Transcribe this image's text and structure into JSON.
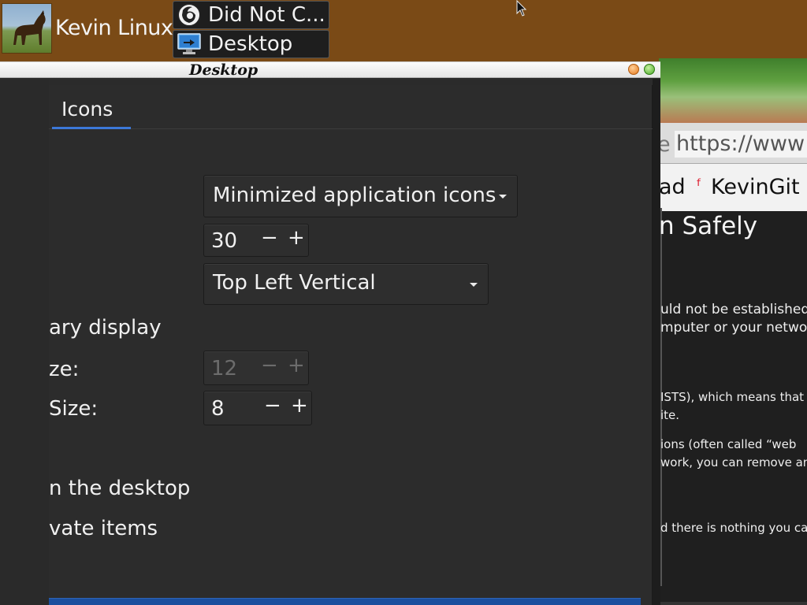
{
  "top_panel": {
    "user_name": "Kevin Linux",
    "tasks": [
      {
        "label": "Did Not C...",
        "icon": "firefox-icon"
      },
      {
        "label": "Desktop",
        "icon": "desktop-monitor-icon"
      }
    ]
  },
  "dock": {
    "items": [
      {
        "name": "internet-explorer-icon"
      },
      {
        "name": "file-cabinet-icon"
      },
      {
        "name": "terminal-icon"
      },
      {
        "name": "magnifier-search-icon"
      }
    ]
  },
  "browser": {
    "url_prefix": "e",
    "url": "https://www",
    "bookmarks": {
      "first": "ad",
      "second": "KevinGit"
    },
    "heading": "n Safely",
    "lines": [
      "uld not be established.",
      "mputer or your network",
      "ISTS), which means that",
      "ite.",
      "ions (often called “web",
      "work, you can remove and",
      "d there is nothing you can"
    ]
  },
  "window": {
    "title": "Desktop",
    "tab": "Icons",
    "icons_dropdown": "Minimized application icons",
    "icon_size": "30",
    "arrangement_dropdown": "Top Left Vertical",
    "labels": {
      "primary": "ary display",
      "size_a": "ze:",
      "size_b": "Size:",
      "on_desktop": "n the desktop",
      "private": "vate items"
    },
    "disabled_size": "12",
    "font_size": "8",
    "minus": "−",
    "plus": "+"
  },
  "colors": {
    "panel_brown": "#7a4a16",
    "window_bg": "#2b2b2b",
    "accent_blue": "#3c78d8"
  }
}
